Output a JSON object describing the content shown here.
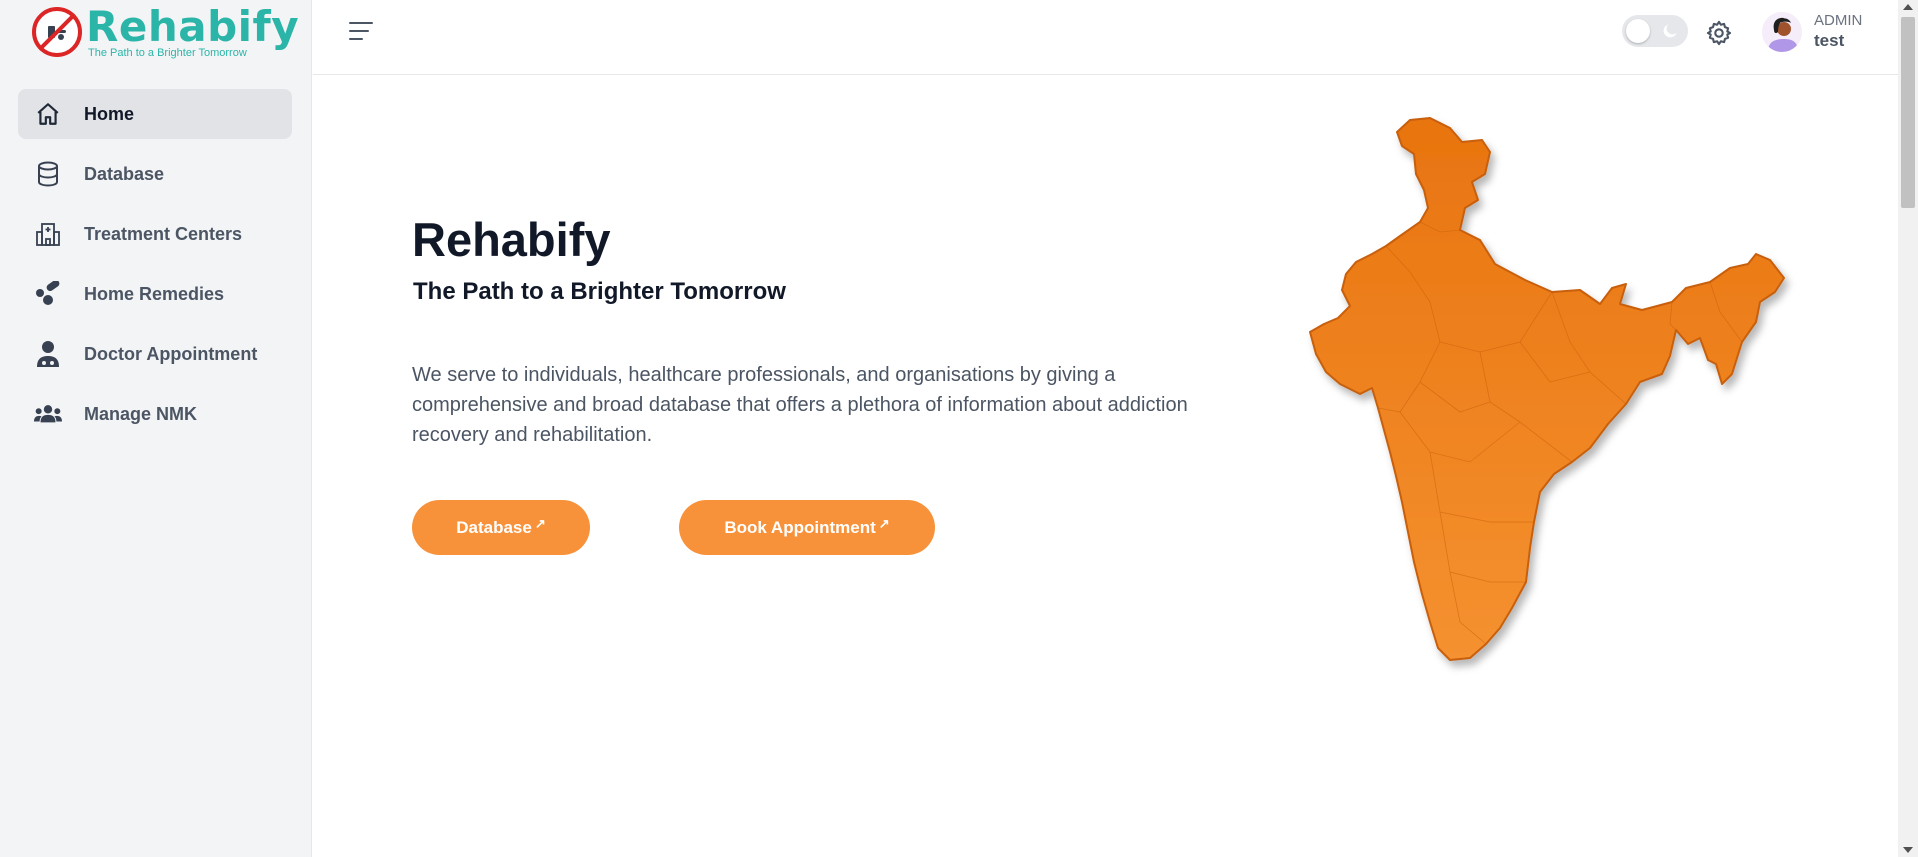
{
  "brand": {
    "name": "Rehabify",
    "tagline": "The Path to a Brighter Tomorrow",
    "color": "#2bb5a8"
  },
  "sidebar": {
    "items": [
      {
        "label": "Home",
        "icon": "home-icon",
        "active": true
      },
      {
        "label": "Database",
        "icon": "database-icon",
        "active": false
      },
      {
        "label": "Treatment Centers",
        "icon": "hospital-icon",
        "active": false
      },
      {
        "label": "Home Remedies",
        "icon": "pills-icon",
        "active": false
      },
      {
        "label": "Doctor Appointment",
        "icon": "doctor-icon",
        "active": false
      },
      {
        "label": "Manage NMK",
        "icon": "users-icon",
        "active": false
      }
    ]
  },
  "header": {
    "theme_toggle_icon": "moon-icon",
    "settings_icon": "gear-icon",
    "user": {
      "role": "ADMIN",
      "name": "test"
    }
  },
  "hero": {
    "title": "Rehabify",
    "subtitle": "The Path to a Brighter Tomorrow",
    "description": "We serve to individuals, healthcare professionals, and organisations by giving a comprehensive and broad database that offers a plethora of information about addiction recovery and rehabilitation.",
    "buttons": {
      "database": "Database",
      "book": "Book Appointment",
      "arrow": "↗"
    },
    "accent_color": "#f7923a",
    "map_color": "#ee7f1f"
  }
}
